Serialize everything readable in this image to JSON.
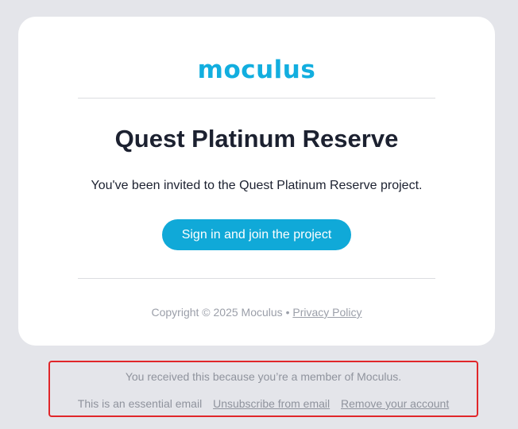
{
  "brand": {
    "logo_text": "moculus",
    "accent_color": "#12aedf"
  },
  "email": {
    "title": "Quest Platinum Reserve",
    "invite_text": "You've been invited to the Quest Platinum Reserve project.",
    "cta_label": "Sign in and join the project",
    "copyright_text": "Copyright © 2025 Moculus •",
    "privacy_link": "Privacy Policy"
  },
  "footer": {
    "reason_text": "You received this because you’re a member of Moculus.",
    "essential_text": "This is an essential email",
    "unsubscribe_link": "Unsubscribe from email",
    "remove_account_link": "Remove your account",
    "highlight_color": "#e0262a"
  }
}
